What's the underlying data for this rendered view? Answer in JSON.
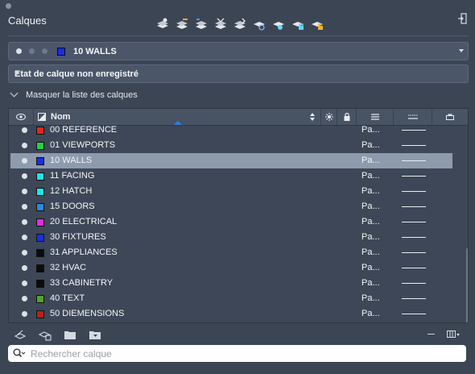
{
  "panel": {
    "title": "Calques"
  },
  "toolbar": {
    "icons": [
      "layer-properties-icon",
      "new-layer-icon",
      "layer-states-icon",
      "layer-walk-icon",
      "layer-merge-icon",
      "freeze-layer-icon",
      "isolate-layer-icon",
      "lock-layer-icon",
      "unlock-layer-icon"
    ]
  },
  "current_layer": {
    "name": "10 WALLS",
    "color": "#1a2ee6"
  },
  "layer_state": {
    "label": "Etat de calque non enregistré"
  },
  "toggle": {
    "label": "Masquer la liste des calques"
  },
  "table": {
    "header_name": "Nom",
    "rows": [
      {
        "name": "00 REFERENCE",
        "color": "#e3271a",
        "type": "Pa...",
        "selected": false
      },
      {
        "name": "01 VIEWPORTS",
        "color": "#25d33a",
        "type": "Pa...",
        "selected": false
      },
      {
        "name": "10 WALLS",
        "color": "#1a2ee6",
        "type": "Pa...",
        "selected": true
      },
      {
        "name": "11 FACING",
        "color": "#20e5e8",
        "type": "Pa...",
        "selected": false
      },
      {
        "name": "12 HATCH",
        "color": "#20e5e8",
        "type": "Pa...",
        "selected": false
      },
      {
        "name": "15 DOORS",
        "color": "#2a8ae0",
        "type": "Pa...",
        "selected": false
      },
      {
        "name": "20 ELECTRICAL",
        "color": "#e02de0",
        "type": "Pa...",
        "selected": false
      },
      {
        "name": "30 FIXTURES",
        "color": "#1a2ee6",
        "type": "Pa...",
        "selected": false
      },
      {
        "name": "31 APPLIANCES",
        "color": "#0b0b0b",
        "type": "Pa...",
        "selected": false
      },
      {
        "name": "32 HVAC",
        "color": "#0b0b0b",
        "type": "Pa...",
        "selected": false
      },
      {
        "name": "33 CABINETRY",
        "color": "#0b0b0b",
        "type": "Pa...",
        "selected": false
      },
      {
        "name": "40 TEXT",
        "color": "#4fa42a",
        "type": "Pa...",
        "selected": false
      },
      {
        "name": "50 DIEMENSIONS",
        "color": "#b8211a",
        "type": "Pa...",
        "selected": false
      }
    ]
  },
  "search": {
    "placeholder": "Rechercher calque"
  }
}
